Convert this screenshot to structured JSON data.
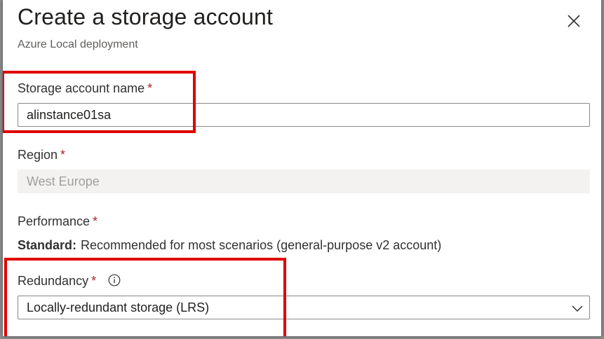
{
  "header": {
    "title": "Create a storage account",
    "subtitle": "Azure Local deployment"
  },
  "icons": {
    "close": "close-icon",
    "info": "info-icon",
    "chevron": "chevron-down-icon"
  },
  "fields": {
    "storage_name": {
      "label": "Storage account name",
      "required": "*",
      "value": "alinstance01sa"
    },
    "region": {
      "label": "Region",
      "required": "*",
      "value": "West Europe"
    },
    "performance": {
      "label": "Performance",
      "required": "*",
      "value_strong": "Standard:",
      "value_text": "Recommended for most scenarios (general-purpose v2 account)"
    },
    "redundancy": {
      "label": "Redundancy",
      "required": "*",
      "value": "Locally-redundant storage (LRS)"
    }
  },
  "colors": {
    "highlight": "#e00000",
    "required": "#a4262c"
  }
}
